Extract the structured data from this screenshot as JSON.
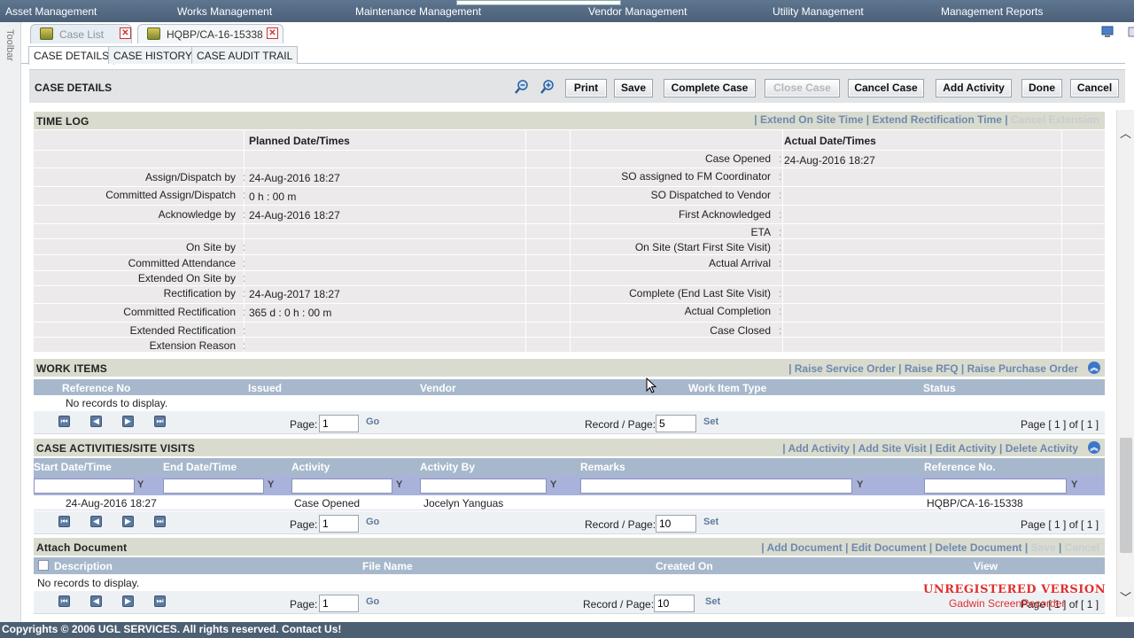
{
  "nav": {
    "items": [
      "Asset Management",
      "Works Management",
      "Maintenance Management",
      "Vendor Management",
      "Utility Management",
      "Management Reports"
    ]
  },
  "toolbar_label": "Toolbar",
  "doc_tabs": [
    {
      "label": "Case List"
    },
    {
      "label": "HQBP/CA-16-15338"
    }
  ],
  "sub_tabs": [
    "CASE DETAILS",
    "CASE HISTORY",
    "CASE AUDIT TRAIL"
  ],
  "header": {
    "title": "CASE DETAILS",
    "buttons": [
      "Print",
      "Save",
      "Complete Case",
      "Close Case",
      "Cancel Case",
      "Add Activity",
      "Done",
      "Cancel"
    ]
  },
  "time_log": {
    "title": "TIME LOG",
    "links": [
      "Extend On Site Time",
      "Extend Rectification Time",
      "Cancel Extension"
    ],
    "planned_header": "Planned Date/Times",
    "actual_header": "Actual Date/Times",
    "planned": [
      {
        "label": "Assign/Dispatch by",
        "value": "24-Aug-2016 18:27"
      },
      {
        "label": "Committed Assign/Dispatch",
        "value": "0 h : 00 m"
      },
      {
        "label": "Acknowledge by",
        "value": "24-Aug-2016 18:27"
      },
      {
        "label": "On Site by",
        "value": ""
      },
      {
        "label": "Committed Attendance",
        "value": ""
      },
      {
        "label": "Extended On Site by",
        "value": ""
      },
      {
        "label": "Rectification by",
        "value": "24-Aug-2017 18:27"
      },
      {
        "label": "Committed Rectification",
        "value": "365 d : 0 h : 00 m"
      },
      {
        "label": "Extended Rectification",
        "value": ""
      },
      {
        "label": "Extension Reason",
        "value": ""
      }
    ],
    "actual": [
      {
        "label": "Case Opened",
        "value": "24-Aug-2016 18:27"
      },
      {
        "label": "SO assigned to FM Coordinator",
        "value": ""
      },
      {
        "label": "SO Dispatched to Vendor",
        "value": ""
      },
      {
        "label": "First Acknowledged",
        "value": ""
      },
      {
        "label": "ETA",
        "value": ""
      },
      {
        "label": "On Site (Start First Site Visit)",
        "value": ""
      },
      {
        "label": "Actual Arrival",
        "value": ""
      },
      {
        "label": "Complete (End Last Site Visit)",
        "value": ""
      },
      {
        "label": "Actual Completion",
        "value": ""
      },
      {
        "label": "Case Closed",
        "value": ""
      }
    ]
  },
  "work_items": {
    "title": "WORK ITEMS",
    "links": [
      "Raise Service Order",
      "Raise RFQ",
      "Raise Purchase Order"
    ],
    "columns": [
      "Reference No",
      "Issued",
      "Vendor",
      "Work Item Type",
      "Status"
    ],
    "empty": "No records to display.",
    "pager": {
      "page_label": "Page:",
      "page": "1",
      "go": "Go",
      "rpp_label": "Record / Page:",
      "rpp": "5",
      "set": "Set",
      "summary": "Page [ 1 ] of [ 1 ]"
    }
  },
  "activities": {
    "title": "CASE ACTIVITIES/SITE VISITS",
    "links": [
      "Add Activity",
      "Add Site Visit",
      "Edit Activity",
      "Delete Activity"
    ],
    "columns": [
      "Start Date/Time",
      "End Date/Time",
      "Activity",
      "Activity By",
      "Remarks",
      "Reference No."
    ],
    "rows": [
      {
        "start": "24-Aug-2016 18:27",
        "end": "",
        "activity": "Case Opened",
        "by": "Jocelyn Yanguas",
        "remarks": "",
        "ref": "HQBP/CA-16-15338"
      }
    ],
    "pager": {
      "page_label": "Page:",
      "page": "1",
      "go": "Go",
      "rpp_label": "Record / Page:",
      "rpp": "10",
      "set": "Set",
      "summary": "Page [ 1 ] of [ 1 ]"
    }
  },
  "attach": {
    "title": "Attach Document",
    "links": [
      "Add Document",
      "Edit Document",
      "Delete Document",
      "Save",
      "Cancel"
    ],
    "columns": [
      "Description",
      "File Name",
      "Created On",
      "View"
    ],
    "empty": "No records to display.",
    "pager": {
      "page_label": "Page:",
      "page": "1",
      "go": "Go",
      "rpp_label": "Record / Page:",
      "rpp": "10",
      "set": "Set",
      "summary": "Page [ 1 ] of [ 1 ]"
    }
  },
  "footer": "Copyrights © 2006 UGL SERVICES. All rights reserved.  Contact Us!",
  "watermark": {
    "line1": "UNREGISTERED VERSION",
    "line2": "Gadwin ScreenRecorder"
  }
}
